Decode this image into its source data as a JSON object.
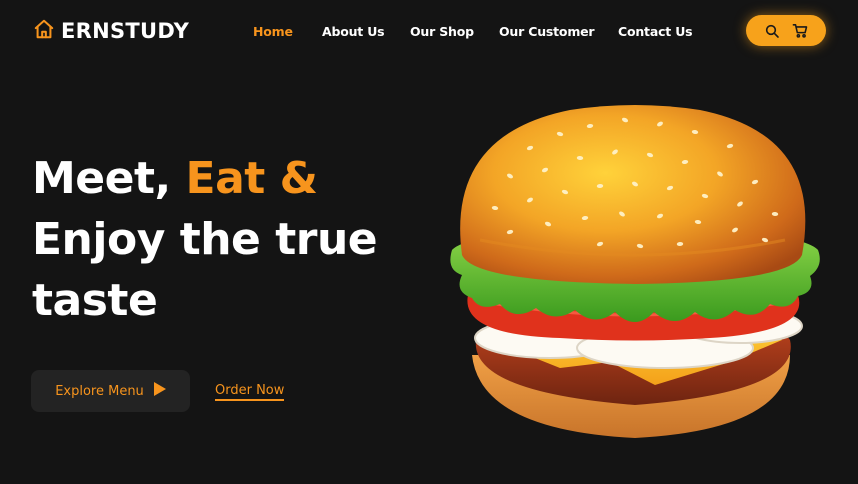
{
  "brand": {
    "name": "ERNSTUDY",
    "icon": "home-icon"
  },
  "nav": {
    "items": [
      {
        "label": "Home",
        "active": true
      },
      {
        "label": "About Us",
        "active": false
      },
      {
        "label": "Our Shop",
        "active": false
      },
      {
        "label": "Our Customer",
        "active": false
      },
      {
        "label": "Contact Us",
        "active": false
      }
    ]
  },
  "header_actions": {
    "icons": [
      "search-icon",
      "cart-icon"
    ],
    "background": "#f7a21b"
  },
  "hero": {
    "line1_white": "Meet, ",
    "line1_accent": "Eat &",
    "line2": "Enjoy the true",
    "line3": "taste",
    "explore_label": "Explore Menu",
    "order_label": "Order Now",
    "image": "burger-illustration"
  },
  "colors": {
    "accent": "#f7941d",
    "background": "#141414",
    "button_bg": "#232323"
  }
}
